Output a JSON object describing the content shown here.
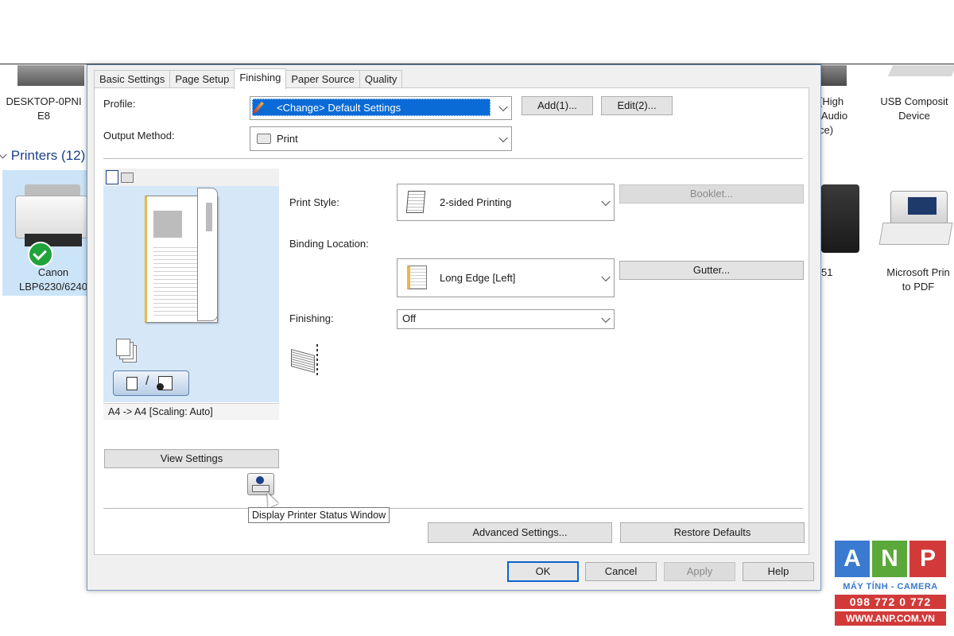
{
  "desktop": {
    "devices_top": [
      {
        "label": "DESKTOP-0PNI\nE8"
      },
      {
        "label": "(High\n Audio\nce)"
      },
      {
        "label": "USB Composit\nDevice"
      }
    ],
    "printers_header": "Printers (12)",
    "printers": [
      {
        "label": "Canon\nLBP6230/6240"
      },
      {
        "label": "51"
      },
      {
        "label": "Microsoft Prin\nto PDF"
      }
    ]
  },
  "dialog": {
    "tabs": [
      "Basic Settings",
      "Page Setup",
      "Finishing",
      "Paper Source",
      "Quality"
    ],
    "active_tab": "Finishing",
    "profile_label": "Profile:",
    "profile_value": "<Change> Default Settings",
    "add_button": "Add(1)...",
    "edit_button": "Edit(2)...",
    "output_method_label": "Output Method:",
    "output_method_value": "Print",
    "preview_caption": "A4 -> A4 [Scaling: Auto]",
    "view_settings_button": "View Settings",
    "tooltip": "Display Printer Status Window",
    "print_style_label": "Print Style:",
    "print_style_value": "2-sided Printing",
    "booklet_button": "Booklet...",
    "binding_location_label": "Binding Location:",
    "binding_location_value": "Long Edge [Left]",
    "gutter_button": "Gutter...",
    "finishing_label": "Finishing:",
    "finishing_value": "Off",
    "advanced_settings_button": "Advanced Settings...",
    "restore_defaults_button": "Restore Defaults",
    "ok_button": "OK",
    "cancel_button": "Cancel",
    "apply_button": "Apply",
    "help_button": "Help"
  },
  "watermark": {
    "letters": [
      "A",
      "N",
      "P"
    ],
    "line1": "MÁY TÍNH - CAMERA",
    "line2": "098 772 0 772",
    "line3": "WWW.ANP.COM.VN",
    "colors": {
      "blue": "#3a7ad0",
      "green": "#5aa83a",
      "red": "#d23a3a"
    }
  }
}
